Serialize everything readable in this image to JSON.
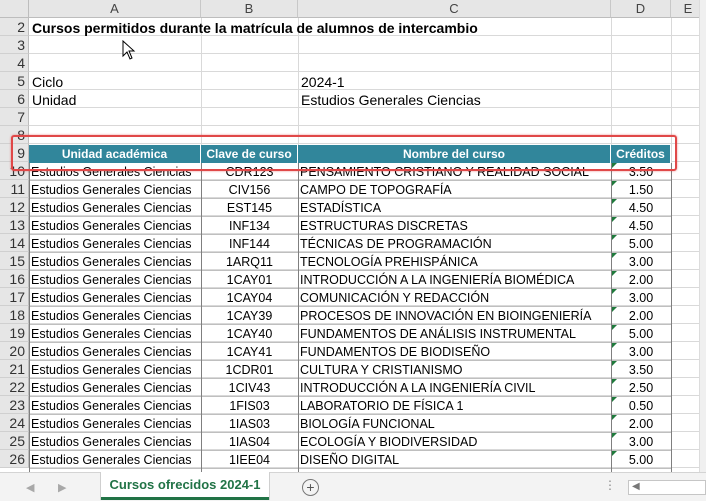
{
  "columns": [
    "A",
    "B",
    "C",
    "D",
    "E"
  ],
  "title": "Cursos permitidos durante la matrícula de alumnos de intercambio",
  "ciclo_label": "Ciclo",
  "ciclo_value": "2024-1",
  "unidad_label": "Unidad",
  "unidad_value": "Estudios Generales Ciencias",
  "table_headers": [
    "Unidad académica",
    "Clave de curso",
    "Nombre del curso",
    "Créditos"
  ],
  "row_numbers": [
    "2",
    "3",
    "4",
    "5",
    "6",
    "7",
    "8",
    "9",
    "10",
    "11",
    "12",
    "13",
    "14",
    "15",
    "16",
    "17",
    "18",
    "19",
    "20",
    "21",
    "22",
    "23",
    "24",
    "25",
    "26"
  ],
  "rows": [
    {
      "unidad": "Estudios Generales Ciencias",
      "clave": "CDR123",
      "curso": "PENSAMIENTO CRISTIANO Y REALIDAD SOCIAL",
      "creditos": "3.50"
    },
    {
      "unidad": "Estudios Generales Ciencias",
      "clave": "CIV156",
      "curso": "CAMPO DE TOPOGRAFÍA",
      "creditos": "1.50"
    },
    {
      "unidad": "Estudios Generales Ciencias",
      "clave": "EST145",
      "curso": "ESTADÍSTICA",
      "creditos": "4.50"
    },
    {
      "unidad": "Estudios Generales Ciencias",
      "clave": "INF134",
      "curso": "ESTRUCTURAS DISCRETAS",
      "creditos": "4.50"
    },
    {
      "unidad": "Estudios Generales Ciencias",
      "clave": "INF144",
      "curso": "TÉCNICAS DE PROGRAMACIÓN",
      "creditos": "5.00"
    },
    {
      "unidad": "Estudios Generales Ciencias",
      "clave": "1ARQ11",
      "curso": "TECNOLOGÍA PREHISPÁNICA",
      "creditos": "3.00"
    },
    {
      "unidad": "Estudios Generales Ciencias",
      "clave": "1CAY01",
      "curso": "INTRODUCCIÓN A LA INGENIERÍA BIOMÉDICA",
      "creditos": "2.00"
    },
    {
      "unidad": "Estudios Generales Ciencias",
      "clave": "1CAY04",
      "curso": "COMUNICACIÓN Y REDACCIÓN",
      "creditos": "3.00"
    },
    {
      "unidad": "Estudios Generales Ciencias",
      "clave": "1CAY39",
      "curso": "PROCESOS DE INNOVACIÓN EN BIOINGENIERÍA",
      "creditos": "2.00"
    },
    {
      "unidad": "Estudios Generales Ciencias",
      "clave": "1CAY40",
      "curso": "FUNDAMENTOS DE ANÁLISIS INSTRUMENTAL",
      "creditos": "5.00"
    },
    {
      "unidad": "Estudios Generales Ciencias",
      "clave": "1CAY41",
      "curso": "FUNDAMENTOS DE BIODISEÑO",
      "creditos": "3.00"
    },
    {
      "unidad": "Estudios Generales Ciencias",
      "clave": "1CDR01",
      "curso": "CULTURA Y CRISTIANISMO",
      "creditos": "3.50"
    },
    {
      "unidad": "Estudios Generales Ciencias",
      "clave": "1CIV43",
      "curso": "INTRODUCCIÓN A LA INGENIERÍA CIVIL",
      "creditos": "2.50"
    },
    {
      "unidad": "Estudios Generales Ciencias",
      "clave": "1FIS03",
      "curso": "LABORATORIO DE FÍSICA 1",
      "creditos": "0.50"
    },
    {
      "unidad": "Estudios Generales Ciencias",
      "clave": "1IAS03",
      "curso": "BIOLOGÍA FUNCIONAL",
      "creditos": "2.00"
    },
    {
      "unidad": "Estudios Generales Ciencias",
      "clave": "1IAS04",
      "curso": "ECOLOGÍA Y BIODIVERSIDAD",
      "creditos": "3.00"
    },
    {
      "unidad": "Estudios Generales Ciencias",
      "clave": "1IEE04",
      "curso": "DISEÑO DIGITAL",
      "creditos": "5.00"
    }
  ],
  "sheet_tab": "Cursos ofrecidos 2024-1",
  "add_sheet_symbol": "+",
  "tab_menu": "⋮",
  "colors": {
    "header_fill": "#31869b",
    "tab_accent": "#217346",
    "highlight": "#e04848"
  }
}
